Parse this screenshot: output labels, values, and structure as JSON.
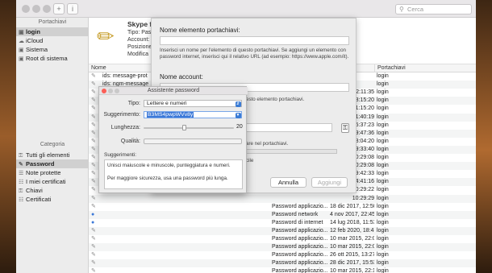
{
  "toolbar": {
    "add_label": "+",
    "info_label": "i",
    "search_placeholder": "Cerca"
  },
  "sidebar": {
    "keychains_header": "Portachiavi",
    "keychains": [
      {
        "label": "login",
        "icon": "lock-open-icon"
      },
      {
        "label": "iCloud",
        "icon": "cloud-icon"
      },
      {
        "label": "Sistema",
        "icon": "lock-icon"
      },
      {
        "label": "Root di sistema",
        "icon": "lock-icon"
      }
    ],
    "category_header": "Categoria",
    "categories": [
      {
        "label": "Tutti gli elementi",
        "icon": "keys-icon"
      },
      {
        "label": "Password",
        "icon": "pencil-icon"
      },
      {
        "label": "Note protette",
        "icon": "note-icon"
      },
      {
        "label": "I miei certificati",
        "icon": "certificate-icon"
      },
      {
        "label": "Chiavi",
        "icon": "key-icon"
      },
      {
        "label": "Certificati",
        "icon": "certificate-icon"
      }
    ]
  },
  "details": {
    "name": "Skype f",
    "lines": [
      "Tipo: Pas",
      "Account:",
      "Posizione:",
      "Modifica"
    ]
  },
  "columns": {
    "name": "Nome",
    "date": "ica",
    "keychain": "Portachiavi"
  },
  "rows": [
    {
      "name": "ids: message-prot",
      "kind": "",
      "date": "",
      "keychain": "login"
    },
    {
      "name": "ids: ngm-message",
      "kind": "",
      "date": "",
      "keychain": "login"
    },
    {
      "name": "",
      "kind": "",
      "date": "2:11:35",
      "keychain": "login"
    },
    {
      "name": "",
      "kind": "",
      "date": "8:15:20",
      "keychain": "login"
    },
    {
      "name": "",
      "kind": "",
      "date": "1:15:20",
      "keychain": "login"
    },
    {
      "name": "",
      "kind": "",
      "date": "11:40:19",
      "keychain": "login"
    },
    {
      "name": "",
      "kind": "",
      "date": "15:37:23",
      "keychain": "login"
    },
    {
      "name": "",
      "kind": "",
      "date": "09:47:36",
      "keychain": "login"
    },
    {
      "name": "",
      "kind": "",
      "date": "8:04:20",
      "keychain": "login"
    },
    {
      "name": "",
      "kind": "",
      "date": "9:33:40",
      "keychain": "login"
    },
    {
      "name": "",
      "kind": "",
      "date": "10:29:08",
      "keychain": "login"
    },
    {
      "name": "",
      "kind": "",
      "date": "10:29:08",
      "keychain": "login"
    },
    {
      "name": "",
      "kind": "",
      "date": "9:42:33",
      "keychain": "login"
    },
    {
      "name": "",
      "kind": "",
      "date": "4:41:16",
      "keychain": "login"
    },
    {
      "name": "",
      "kind": "",
      "date": "10:29:22",
      "keychain": "login"
    },
    {
      "name": "",
      "kind": "",
      "date": "10:29:29",
      "keychain": "login"
    },
    {
      "name": "",
      "kind": "Password applicazio...",
      "date": "18 dic 2017, 12:50:58",
      "keychain": "login"
    },
    {
      "name": "",
      "kind": "Password network",
      "date": "4 nov 2017, 22:45:05",
      "keychain": "login"
    },
    {
      "name": "",
      "kind": "Password di internet",
      "date": "14 lug 2018, 11:53:06",
      "keychain": "login"
    },
    {
      "name": "",
      "kind": "Password applicazio...",
      "date": "12 feb 2020, 18:41:50",
      "keychain": "login"
    },
    {
      "name": "",
      "kind": "Password applicazio...",
      "date": "10 mar 2015, 22:05:24",
      "keychain": "login"
    },
    {
      "name": "",
      "kind": "Password applicazio...",
      "date": "10 mar 2015, 22:05:24",
      "keychain": "login"
    },
    {
      "name": "",
      "kind": "Password applicazio...",
      "date": "26 ott 2015, 13:27:20",
      "keychain": "login"
    },
    {
      "name": "",
      "kind": "Password applicazio...",
      "date": "28 dic 2017, 15:53:42",
      "keychain": "login"
    },
    {
      "name": "",
      "kind": "Password applicazio...",
      "date": "10 mar 2015, 22:14:31",
      "keychain": "login"
    }
  ],
  "edit_sheet": {
    "name_label": "Nome elemento portachiavi:",
    "name_help": "Inserisci un nome per l'elemento di questo portachiavi. Se aggiungi un elemento con password internet, inserisci qui il relativo URL (ad esempio: https://www.apple.com/it).",
    "account_label": "Nome account:",
    "account_help": "esto elemento portachiavi.",
    "password_help": "are nel portachiavi.",
    "show_password_label": "cile",
    "cancel_label": "Annulla",
    "add_label": "Aggiungi"
  },
  "assistant": {
    "title": "Assistente password",
    "type_label": "Tipo:",
    "type_value": "Lettere e numeri",
    "suggestion_label": "Suggerimento:",
    "suggestion_value": "B3MS4pwpWVv8y",
    "length_label": "Lunghezza:",
    "length_value": "20",
    "length_fraction": 0.45,
    "quality_label": "Qualità:",
    "tips_label": "Suggerimenti:",
    "tips": [
      "Unisci maiuscole e minuscole, punteggiatura e numeri.",
      "Per maggiore sicurezza, usa una password più lunga."
    ]
  }
}
